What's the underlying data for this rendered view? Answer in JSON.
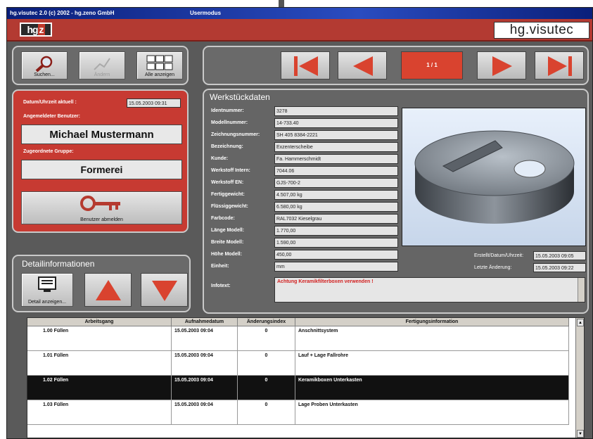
{
  "window": {
    "title": "hg.visutec 2.0  (c) 2002 - hg.zeno GmbH",
    "mode": "Usermodus"
  },
  "header": {
    "logo_left": "hg",
    "logo_right": "z",
    "brand": "hg.visutec"
  },
  "toolbar": {
    "search_label": "Suchen...",
    "change_label": "Ändern",
    "show_all_label": "Alle anzeigen"
  },
  "nav": {
    "counter": "1 / 1"
  },
  "user_panel": {
    "datetime_label": "Datum/Uhrzeit aktuell :",
    "datetime_value": "15.05.2003  09:31",
    "user_label": "Angemeldeter Benutzer:",
    "user_value": "Michael Mustermann",
    "group_label": "Zugeordnete Gruppe:",
    "group_value": "Formerei",
    "logout_label": "Benutzer abmelden"
  },
  "detail_panel": {
    "title": "Detailinformationen",
    "show_detail_label": "Detail anzeigen..."
  },
  "workpiece": {
    "title": "Werkstückdaten",
    "fields": [
      {
        "label": "Identnummer:",
        "value": "3278"
      },
      {
        "label": "Modellnummer:",
        "value": "14-733.40"
      },
      {
        "label": "Zeichnungsnummer:",
        "value": "SH 405 8384-2221"
      },
      {
        "label": "Bezeichnung:",
        "value": "Exzenterscheibe"
      },
      {
        "label": "Kunde:",
        "value": "Fa. Hammerschmidt"
      },
      {
        "label": "Werkstoff Intern:",
        "value": "7044.06"
      },
      {
        "label": "Werkstoff EN:",
        "value": "GJS-700-2"
      },
      {
        "label": "Fertiggewicht:",
        "value": "4.507,00 kg"
      },
      {
        "label": "Flüssiggewicht:",
        "value": "6.580,00 kg"
      },
      {
        "label": "Farbcode:",
        "value": "RAL7032 Kieselgrau"
      },
      {
        "label": "Länge Modell:",
        "value": "1.770,00"
      },
      {
        "label": "Breite Modell:",
        "value": "1.590,00"
      },
      {
        "label": "Höhe Modell:",
        "value": "450,00"
      },
      {
        "label": "Einheit:",
        "value": "mm"
      }
    ],
    "info_label": "Infotext:",
    "info_value": "Achtung Keramikfilterboxen verwenden !",
    "created_label": "Erstellt/Datum/Uhrzeit:",
    "created_value": "15.05.2003  09:05",
    "changed_label": "Letzte Änderung:",
    "changed_value": "15.05.2003  09:22"
  },
  "table": {
    "columns": [
      "Arbeitsgang",
      "Aufnahmedatum",
      "Änderungsindex",
      "Fertigungsinformation"
    ],
    "rows": [
      {
        "step": "1.00 Füllen",
        "date": "15.05.2003  09:04",
        "index": "0",
        "info": "Anschnittsystem",
        "selected": false
      },
      {
        "step": "1.01 Füllen",
        "date": "15.05.2003  09:04",
        "index": "0",
        "info": "Lauf + Lage Fallrohre",
        "selected": false
      },
      {
        "step": "1.02 Füllen",
        "date": "15.05.2003  09:04",
        "index": "0",
        "info": "Keramikboxen Unterkasten",
        "selected": true
      },
      {
        "step": "1.03 Füllen",
        "date": "15.05.2003  09:04",
        "index": "0",
        "info": "Lage Proben Unterkasten",
        "selected": false
      }
    ]
  },
  "colors": {
    "header_red": "#b33a32",
    "panel_red": "#c73a32",
    "nav_arrow": "#d9432f",
    "selected_row": "#111111"
  }
}
